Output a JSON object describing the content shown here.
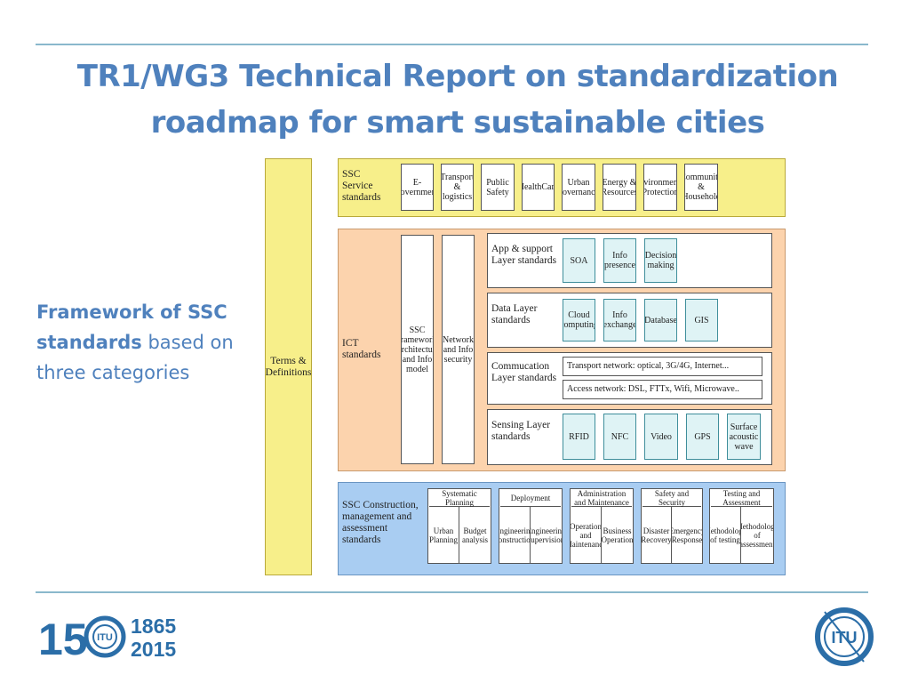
{
  "title": "TR1/WG3 Technical Report on standardization roadmap for smart sustainable cities",
  "side": {
    "bold": "Framework of SSC standards",
    "rest": " based on three categories"
  },
  "terms": "Terms & Definitions",
  "service": {
    "label": "SSC Service standards",
    "items": [
      "E-government",
      "Transport & logistics",
      "Public Safety",
      "HealthCare",
      "Urban governance",
      "Energy & Resources",
      "Environmental Protection",
      "Community & Household"
    ]
  },
  "ict": {
    "label": "ICT standards",
    "framework": "SSC Framework, Architecture and Info model",
    "network": "Network and Info security",
    "app": {
      "label": "App & support Layer standards",
      "items": [
        "SOA",
        "Info presence",
        "Decision making"
      ]
    },
    "data": {
      "label": "Data Layer standards",
      "items": [
        "Cloud computing",
        "Info exchange",
        "Database",
        "GIS"
      ]
    },
    "comm": {
      "label": "Commucation Layer standards",
      "transport": "Transport network: optical, 3G/4G, Internet...",
      "access": "Access network: DSL, FTTx, Wifi, Microwave.."
    },
    "sensing": {
      "label": "Sensing Layer standards",
      "items": [
        "RFID",
        "NFC",
        "Video",
        "GPS",
        "Surface acoustic wave"
      ]
    }
  },
  "construction": {
    "label": "SSC Construction, management and assessment standards",
    "groups": [
      {
        "title": "Systematic Planning",
        "items": [
          "Urban Planning",
          "Budget analysis"
        ]
      },
      {
        "title": "Deployment",
        "items": [
          "Engineering construction",
          "Engineering supervision"
        ]
      },
      {
        "title": "Administration and Maintenance",
        "items": [
          "Operation and Maintenance",
          "Business Operation"
        ]
      },
      {
        "title": "Safety and Security",
        "items": [
          "Disaster Recovery",
          "Emergency Response"
        ]
      },
      {
        "title": "Testing and Assessment",
        "items": [
          "Methodology of testing",
          "Methodology of assessment"
        ]
      }
    ]
  },
  "footer": {
    "years_top": "1865",
    "years_bottom": "2015",
    "big_digit": "15",
    "itu": "ITU"
  },
  "colors": {
    "title": "#4f81bd",
    "yellow": "#f7ef8a",
    "orange": "#fcd3ad",
    "blue": "#a9cdf2",
    "teal": "#dff3f5"
  }
}
